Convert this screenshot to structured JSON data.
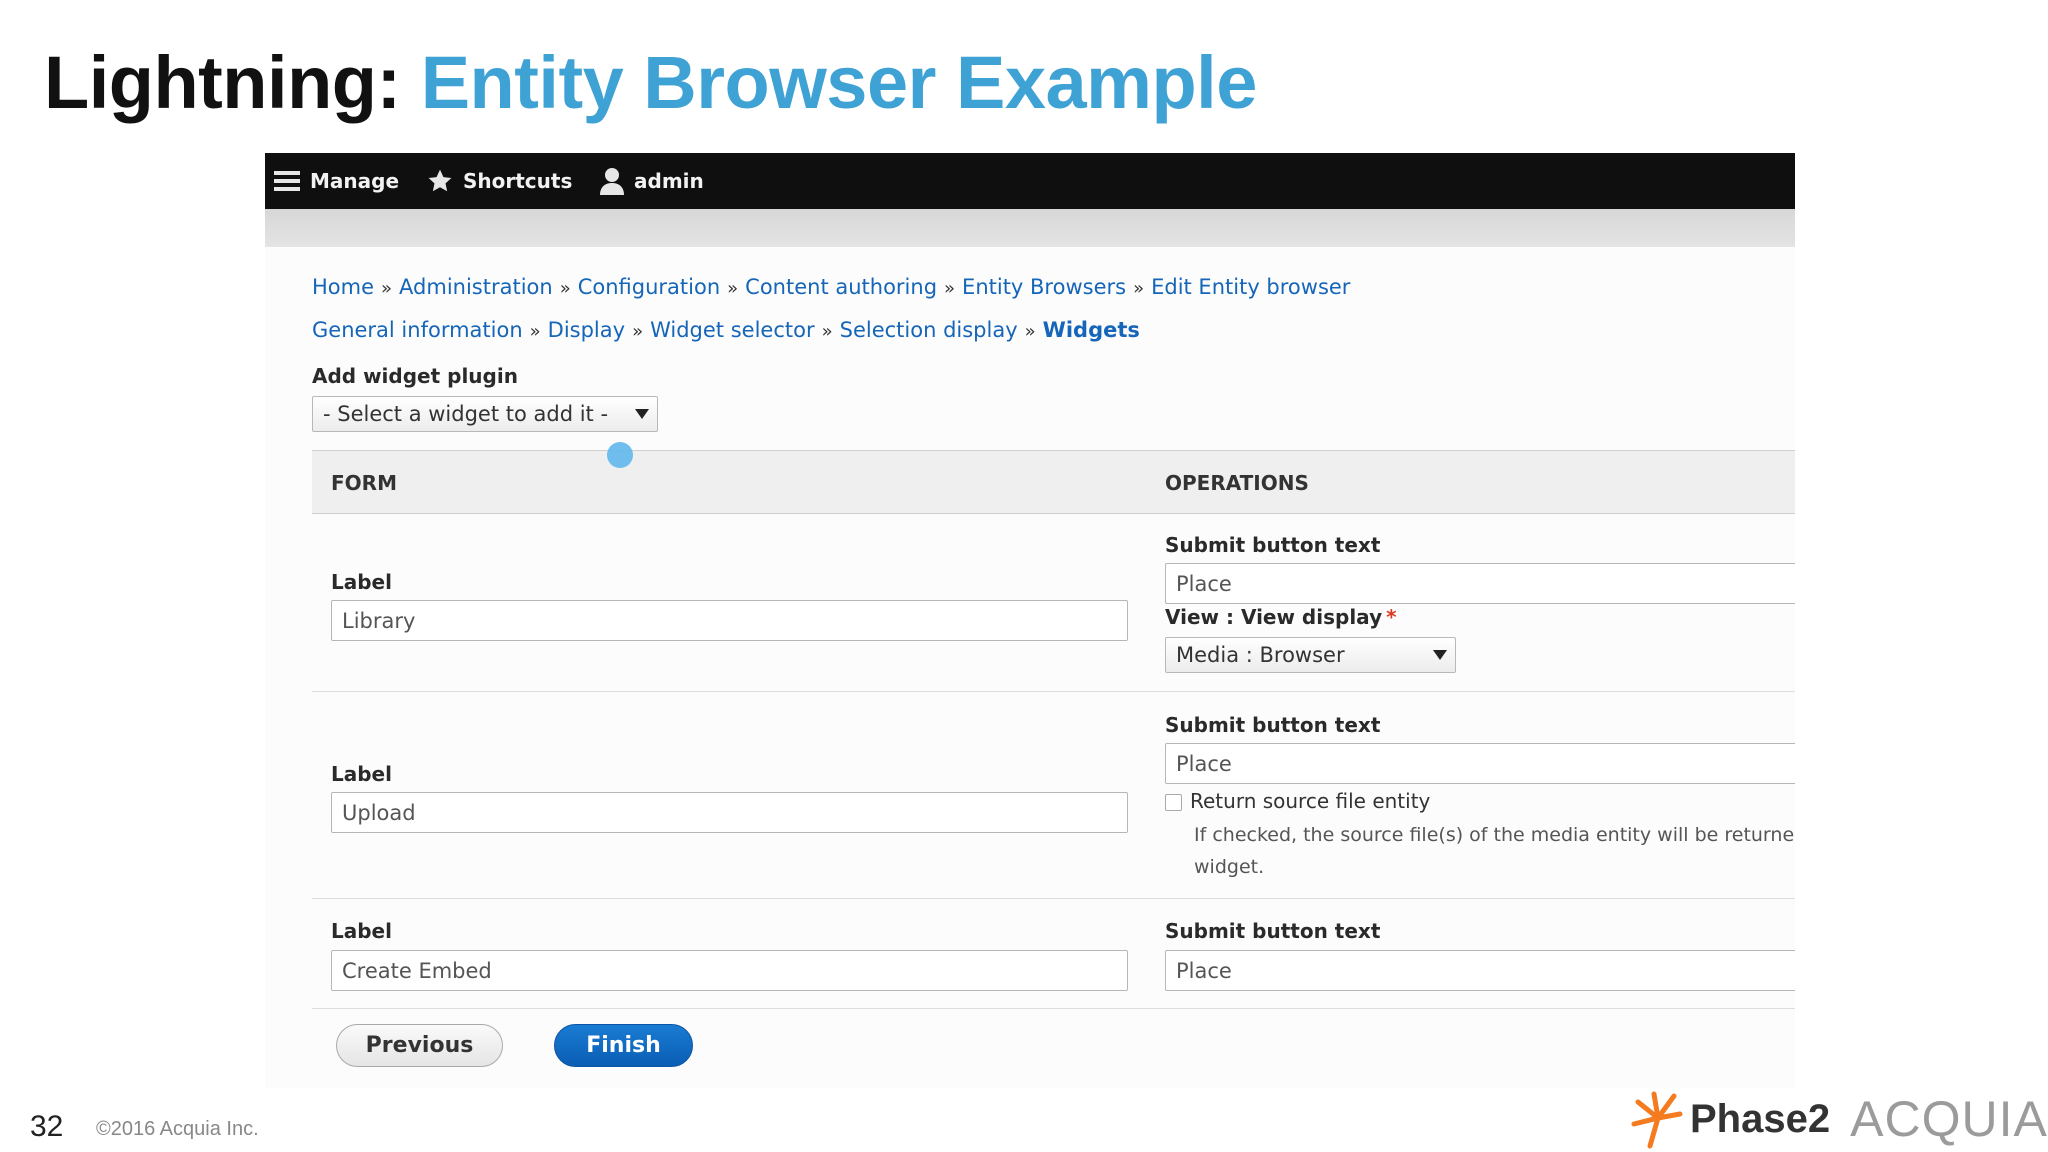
{
  "slide": {
    "title_prefix": "Lightning:",
    "title_main": "Entity Browser Example",
    "page_number": "32",
    "copyright": "©2016 Acquia Inc.",
    "logo_phase2": "Phase2",
    "logo_acquia": "ACQUIA"
  },
  "toolbar": {
    "manage": "Manage",
    "shortcuts": "Shortcuts",
    "user": "admin"
  },
  "breadcrumb": {
    "items": [
      "Home",
      "Administration",
      "Configuration",
      "Content authoring",
      "Entity Browsers",
      "Edit Entity browser"
    ],
    "separator": "»"
  },
  "wizard_steps": {
    "items": [
      "General information",
      "Display",
      "Widget selector",
      "Selection display",
      "Widgets"
    ],
    "separator": "»"
  },
  "add_widget": {
    "label": "Add widget plugin",
    "select_value": "- Select a widget to add it -"
  },
  "table": {
    "col_form": "FORM",
    "col_operations": "OPERATIONS",
    "rows": [
      {
        "label_title": "Label",
        "label_value": "Library",
        "submit_title": "Submit button text",
        "submit_value": "Place",
        "view_title": "View : View display",
        "required_mark": "*",
        "view_value": "Media : Browser"
      },
      {
        "label_title": "Label",
        "label_value": "Upload",
        "submit_title": "Submit button text",
        "submit_value": "Place",
        "checkbox_label": "Return source file entity",
        "checkbox_desc_1": "If checked, the source file(s) of the media entity will be returned",
        "checkbox_desc_2": "widget."
      },
      {
        "label_title": "Label",
        "label_value": "Create Embed",
        "submit_title": "Submit button text",
        "submit_value": "Place"
      }
    ]
  },
  "actions": {
    "previous": "Previous",
    "finish": "Finish"
  },
  "colors": {
    "title_accent": "#3fa2d5",
    "link": "#1565b8",
    "primary_button": "#0a5eb4",
    "toolbar_bg": "#0f0f0f"
  }
}
